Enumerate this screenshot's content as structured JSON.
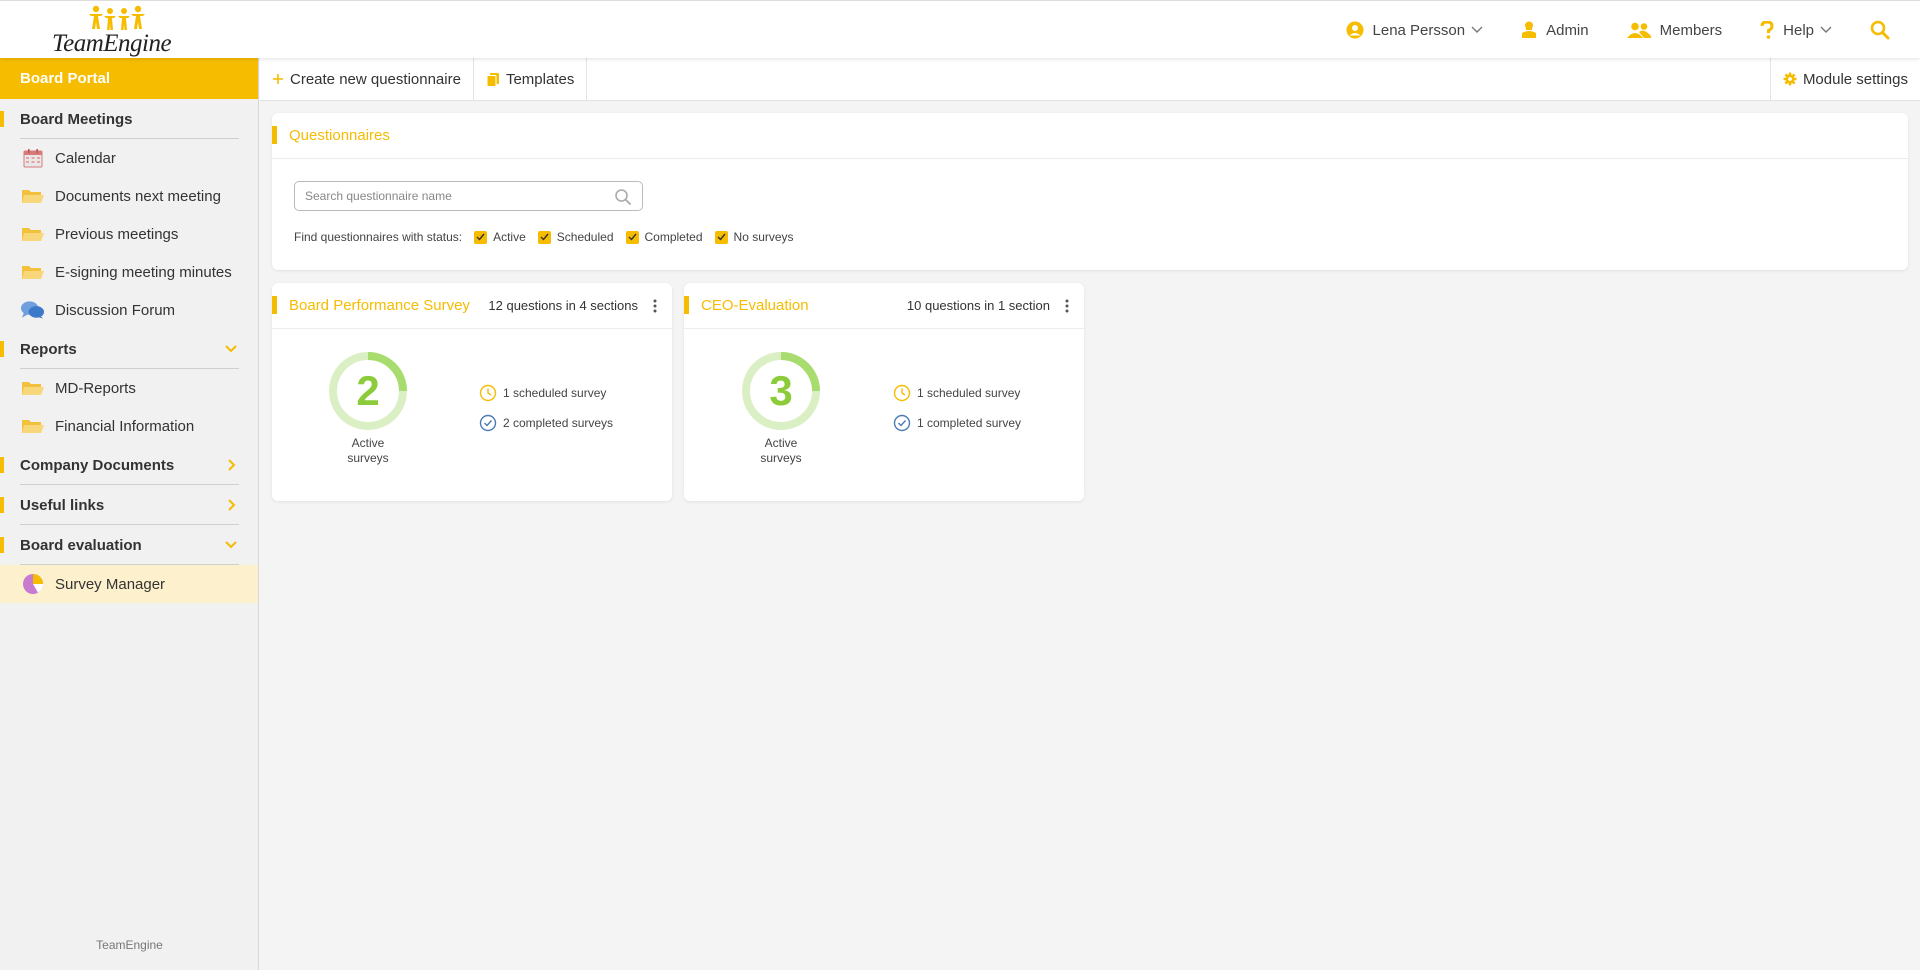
{
  "header": {
    "logo_text": "TeamEngine",
    "user": "Lena Persson",
    "admin": "Admin",
    "members": "Members",
    "help": "Help"
  },
  "sidebar": {
    "portal": "Board Portal",
    "board_meetings": {
      "title": "Board Meetings",
      "items": [
        "Calendar",
        "Documents next meeting",
        "Previous meetings",
        "E-signing meeting minutes",
        "Discussion Forum"
      ]
    },
    "reports": {
      "title": "Reports",
      "items": [
        "MD-Reports",
        "Financial Information"
      ]
    },
    "company_documents": "Company Documents",
    "useful_links": "Useful links",
    "board_evaluation": {
      "title": "Board evaluation",
      "items": [
        "Survey Manager"
      ]
    },
    "footer": "TeamEngine"
  },
  "toolbar": {
    "create": "Create new questionnaire",
    "templates": "Templates",
    "module_settings": "Module settings"
  },
  "questionnaires": {
    "title": "Questionnaires",
    "search_placeholder": "Search questionnaire name",
    "filter_label": "Find questionnaires with status:",
    "filters": [
      "Active",
      "Scheduled",
      "Completed",
      "No surveys"
    ]
  },
  "cards": [
    {
      "title": "Board Performance Survey",
      "meta": "12 questions in 4 sections",
      "active_count": "2",
      "active_label_1": "Active",
      "active_label_2": "surveys",
      "scheduled": "1 scheduled survey",
      "completed": "2 completed surveys"
    },
    {
      "title": "CEO-Evaluation",
      "meta": "10 questions in 1 section",
      "active_count": "3",
      "active_label_1": "Active",
      "active_label_2": "surveys",
      "scheduled": "1 scheduled survey",
      "completed": "1 completed survey"
    }
  ],
  "colors": {
    "accent": "#f5bc00",
    "donut": "#8ccb3a",
    "donut_track": "#d9f0c2",
    "active_bg": "#fdf1cd"
  }
}
